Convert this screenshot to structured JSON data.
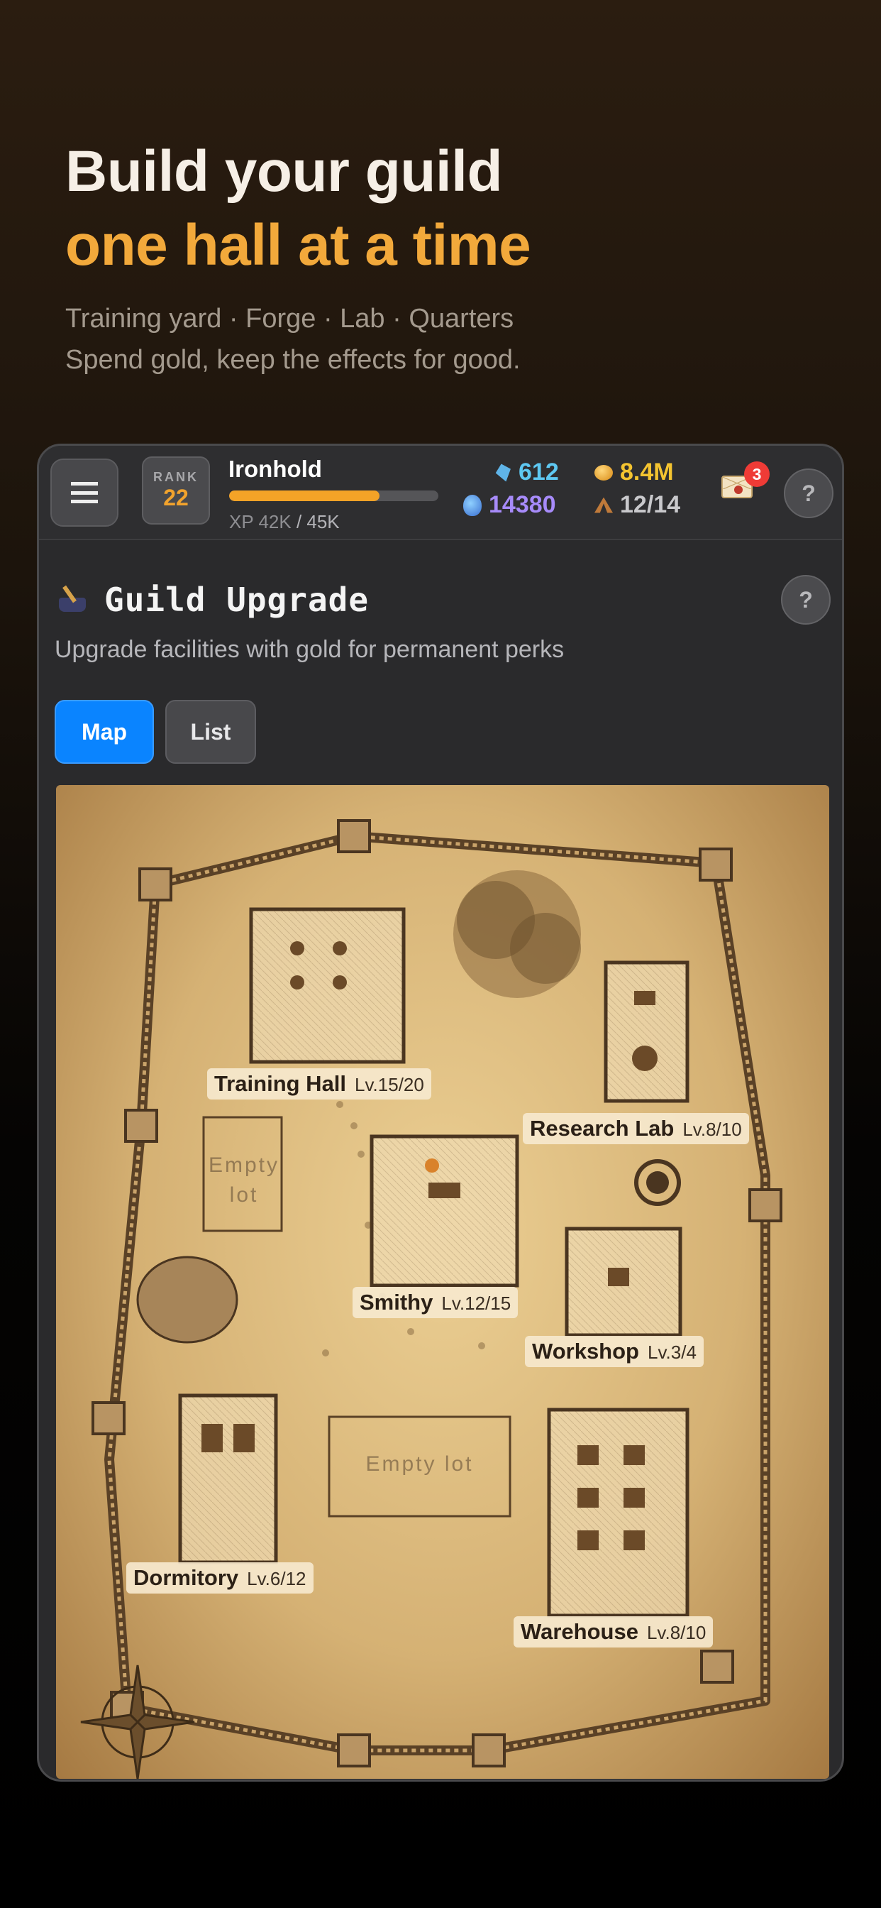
{
  "hero": {
    "line1": "Build your guild",
    "line2": "one hall at a time",
    "sub1": "Training yard · Forge · Lab · Quarters",
    "sub2": "Spend gold, keep the effects for good."
  },
  "topbar": {
    "rank_label": "RANK",
    "rank_value": "22",
    "player_name": "Ironhold",
    "xp_label": "XP 42K",
    "xp_max": "/ 45K",
    "xp_progress": 0.72,
    "gems": "612",
    "crystals": "14380",
    "gold": "8.4M",
    "workers": "12/14",
    "mail_count": "3",
    "help": "?"
  },
  "panel": {
    "title": "Guild Upgrade",
    "subtitle": "Upgrade facilities with gold for permanent perks",
    "help": "?",
    "tabs": [
      {
        "label": "Map",
        "active": true
      },
      {
        "label": "List",
        "active": false
      }
    ]
  },
  "map": {
    "buildings": [
      {
        "name": "Training Hall",
        "level": "Lv.15/20"
      },
      {
        "name": "Research Lab",
        "level": "Lv.8/10"
      },
      {
        "name": "Smithy",
        "level": "Lv.12/15"
      },
      {
        "name": "Workshop",
        "level": "Lv.3/4"
      },
      {
        "name": "Dormitory",
        "level": "Lv.6/12"
      },
      {
        "name": "Warehouse",
        "level": "Lv.8/10"
      }
    ],
    "empty_lots": [
      "Empty lot",
      "Empty lot"
    ]
  },
  "colors": {
    "accent": "#0a84ff",
    "hero_highlight": "#f2a93b",
    "gem": "#5ec8f2",
    "crystal": "#a78bfa",
    "gold": "#f4c430"
  }
}
